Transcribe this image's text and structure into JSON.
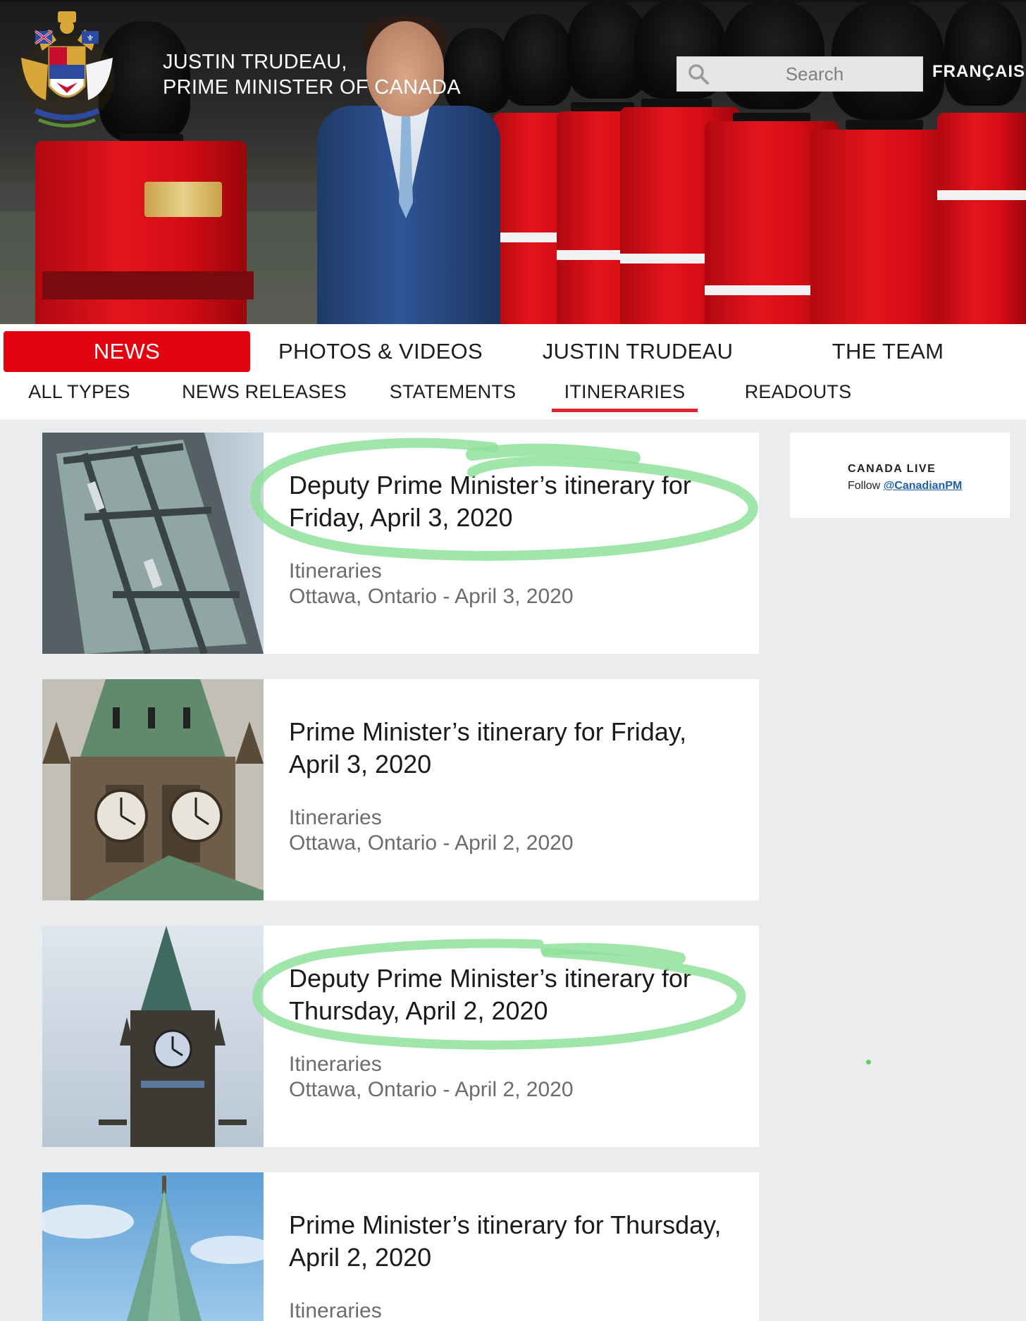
{
  "header": {
    "title_line1": "JUSTIN TRUDEAU,",
    "title_line2": "PRIME MINISTER OF CANADA",
    "search_placeholder": "Search",
    "language_link": "FRANÇAIS"
  },
  "nav": {
    "main": [
      {
        "label": "NEWS",
        "active": true
      },
      {
        "label": "PHOTOS & VIDEOS",
        "active": false
      },
      {
        "label": "JUSTIN TRUDEAU",
        "active": false
      },
      {
        "label": "THE TEAM",
        "active": false
      }
    ],
    "sub": [
      {
        "label": "ALL TYPES",
        "active": false
      },
      {
        "label": "NEWS RELEASES",
        "active": false
      },
      {
        "label": "STATEMENTS",
        "active": false
      },
      {
        "label": "ITINERARIES",
        "active": true
      },
      {
        "label": "READOUTS",
        "active": false
      }
    ]
  },
  "cards": [
    {
      "title": "Deputy Prime Minister’s itinerary for Friday, April 3, 2020",
      "category": "Itineraries",
      "meta": "Ottawa, Ontario - April 3, 2020",
      "circled": true
    },
    {
      "title": "Prime Minister’s itinerary for Friday, April 3, 2020",
      "category": "Itineraries",
      "meta": "Ottawa, Ontario - April 2, 2020",
      "circled": false
    },
    {
      "title": "Deputy Prime Minister’s itinerary for Thursday, April 2, 2020",
      "category": "Itineraries",
      "meta": "Ottawa, Ontario - April 2, 2020",
      "circled": true
    },
    {
      "title": "Prime Minister’s itinerary for Thursday, April 2, 2020",
      "category": "Itineraries",
      "meta": "",
      "circled": false
    }
  ],
  "sidebar": {
    "label": "CANADA LIVE",
    "follow_prefix": "Follow ",
    "follow_handle": "@CanadianPM"
  },
  "colors": {
    "accent_red": "#e3030f",
    "underline_red": "#d9252d",
    "annotation_green": "#8fe09a",
    "link_blue": "#1f5fa8"
  }
}
